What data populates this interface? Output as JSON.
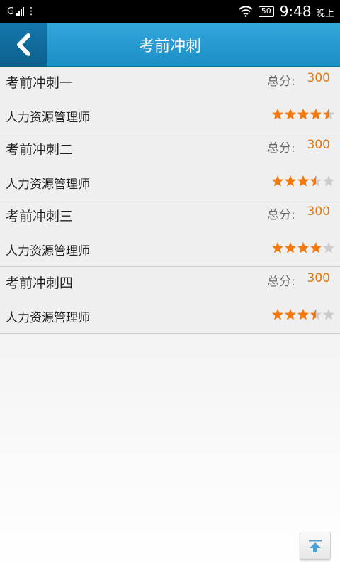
{
  "status_bar": {
    "carrier": "G",
    "time": "9:48",
    "ampm": "晚上",
    "battery": "50"
  },
  "header": {
    "title": "考前冲刺"
  },
  "colors": {
    "accent": "#1c8ec7",
    "score": "#e07a10",
    "star_filled": "#f07a10",
    "star_empty": "#cccccc"
  },
  "list": [
    {
      "title": "考前冲刺一",
      "score_label": "总分:",
      "score": "300",
      "subject": "人力资源管理师",
      "rating": 4.5
    },
    {
      "title": "考前冲刺二",
      "score_label": "总分:",
      "score": "300",
      "subject": "人力资源管理师",
      "rating": 3.5
    },
    {
      "title": "考前冲刺三",
      "score_label": "总分:",
      "score": "300",
      "subject": "人力资源管理师",
      "rating": 4
    },
    {
      "title": "考前冲刺四",
      "score_label": "总分:",
      "score": "300",
      "subject": "人力资源管理师",
      "rating": 3.5
    }
  ],
  "icons": {
    "back": "chevron-left-icon",
    "scroll_top": "arrow-up-icon"
  }
}
